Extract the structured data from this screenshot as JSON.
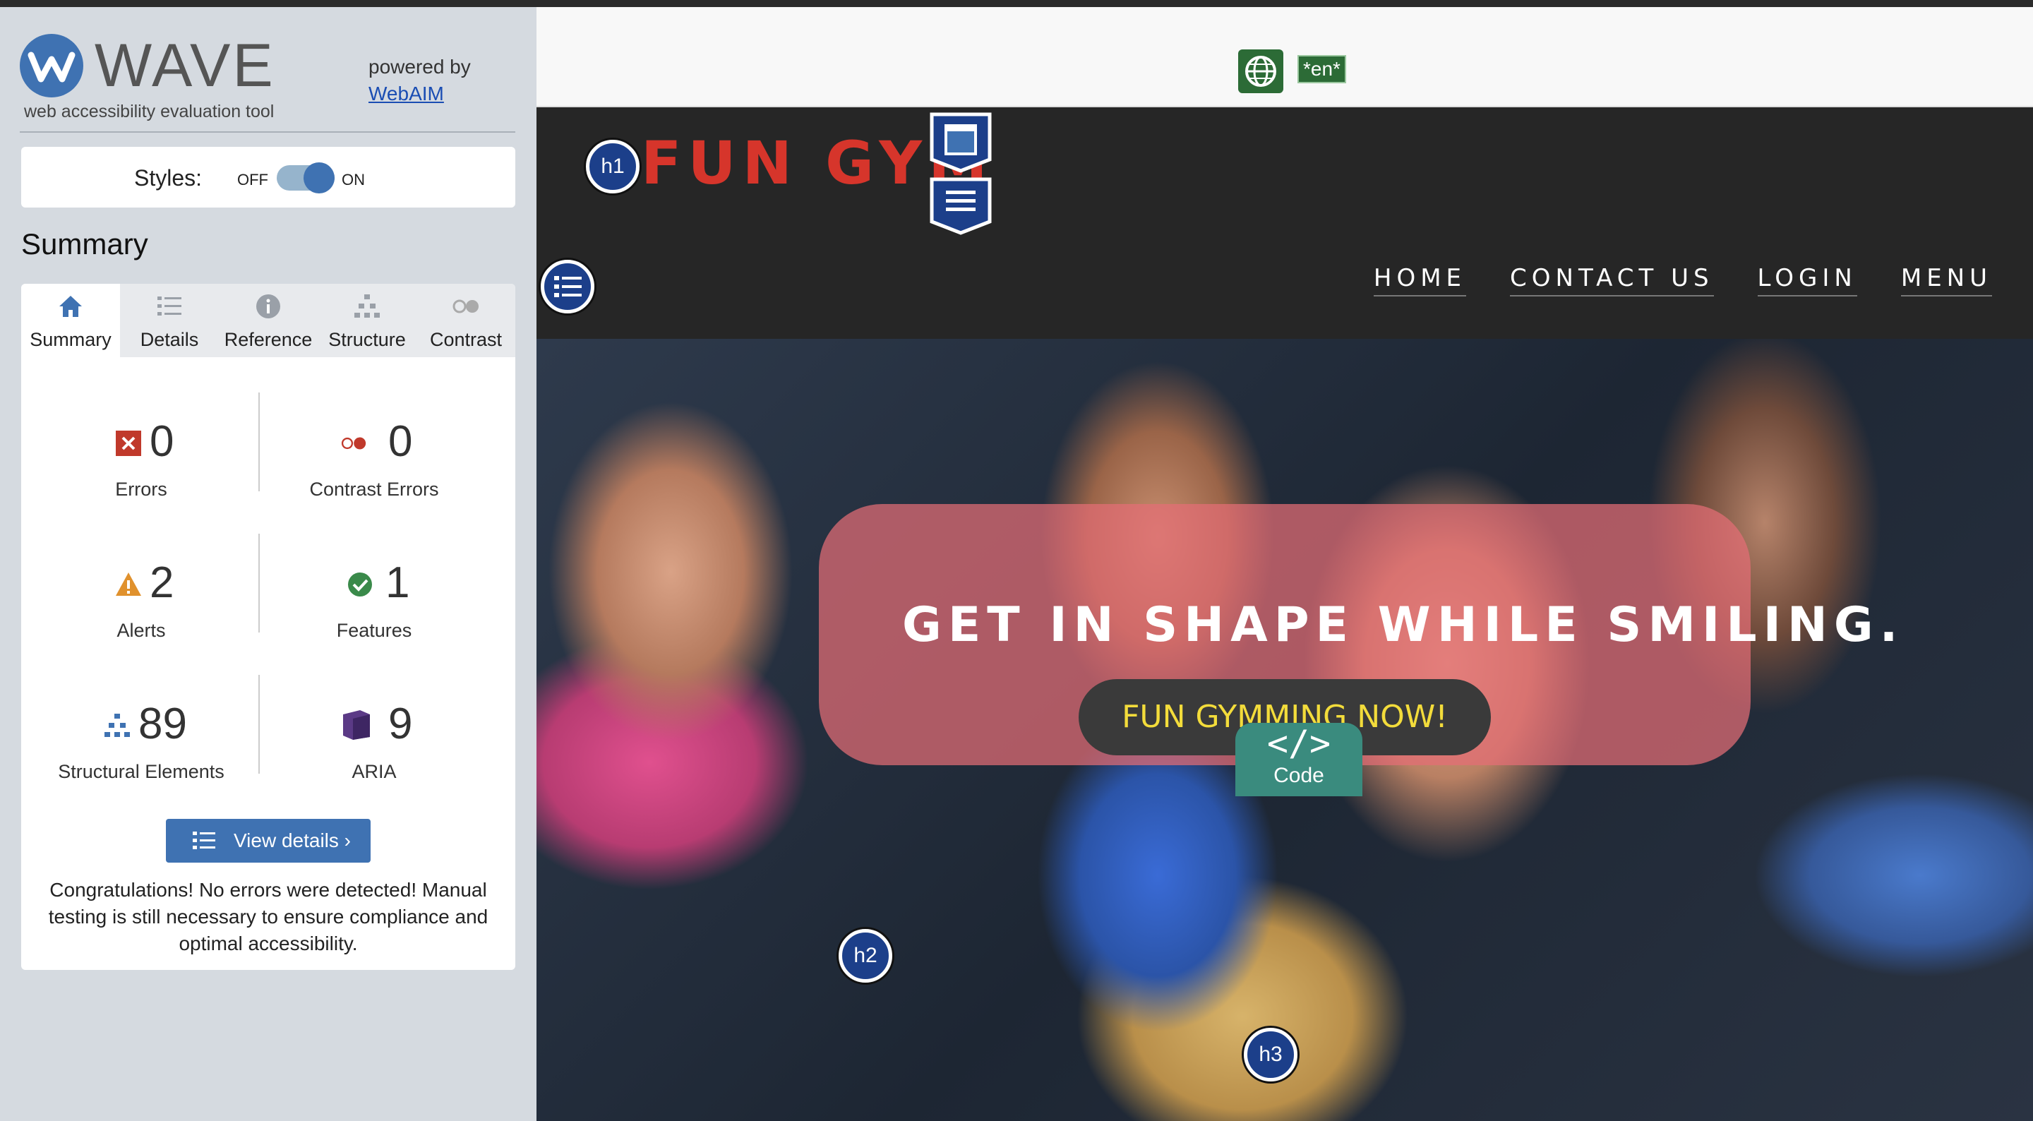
{
  "sidebar": {
    "logo_word": "WAVE",
    "logo_sub": "web accessibility evaluation tool",
    "powered_by": "powered by",
    "powered_link": "WebAIM",
    "styles_label": "Styles:",
    "toggle_off": "OFF",
    "toggle_on": "ON",
    "styles_enabled": true,
    "summary_heading": "Summary",
    "tabs": [
      {
        "label": "Summary",
        "icon": "home-icon",
        "active": true
      },
      {
        "label": "Details",
        "icon": "list-icon",
        "active": false
      },
      {
        "label": "Reference",
        "icon": "info-icon",
        "active": false
      },
      {
        "label": "Structure",
        "icon": "hierarchy-icon",
        "active": false
      },
      {
        "label": "Contrast",
        "icon": "contrast-icon",
        "active": false
      }
    ],
    "stats": {
      "errors": {
        "value": "0",
        "label": "Errors",
        "color": "#c0392b"
      },
      "contrast_errors": {
        "value": "0",
        "label": "Contrast Errors",
        "color": "#c0392b"
      },
      "alerts": {
        "value": "2",
        "label": "Alerts",
        "color": "#e0912d"
      },
      "features": {
        "value": "1",
        "label": "Features",
        "color": "#3a8a4a"
      },
      "structural": {
        "value": "89",
        "label": "Structural Elements",
        "color": "#3f72b2"
      },
      "aria": {
        "value": "9",
        "label": "ARIA",
        "color": "#5b3a86"
      }
    },
    "view_details": "View details ›",
    "congrats": "Congratulations! No errors were detected! Manual testing is still necessary to ensure compliance and optimal accessibility."
  },
  "page": {
    "lang_tag": "*en*",
    "site_title": "FUN GYM",
    "badges": {
      "h1": "h1",
      "h2": "h2",
      "h3": "h3"
    },
    "nav": [
      "HOME",
      "CONTACT US",
      "LOGIN",
      "MENU"
    ],
    "hero_title": "GET IN SHAPE WHILE SMILING.",
    "cta": "FUN GYMMING NOW!",
    "code_glyph": "</>",
    "code_label": "Code"
  },
  "colors": {
    "accent": "#3f72b2",
    "sidebar_bg": "#d5dae0",
    "header_bg": "#262626",
    "title_red": "#d6352b",
    "cta_yellow": "#f3dc3b"
  }
}
